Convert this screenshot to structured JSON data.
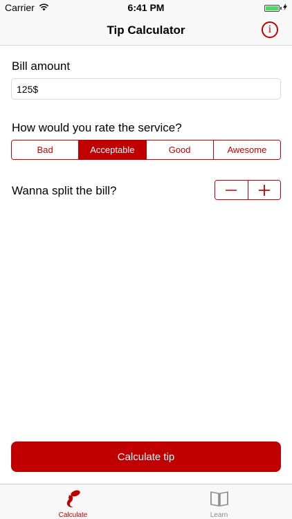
{
  "status_bar": {
    "carrier": "Carrier",
    "time": "6:41 PM",
    "battery_level": 1.0,
    "battery_color": "#4cd964"
  },
  "nav": {
    "title": "Tip Calculator",
    "info_icon": "info-circle-icon",
    "info_glyph": "i"
  },
  "bill": {
    "label": "Bill amount",
    "value": "125$"
  },
  "service": {
    "label": "How would you rate the service?",
    "options": [
      "Bad",
      "Acceptable",
      "Good",
      "Awesome"
    ],
    "selected": "Acceptable"
  },
  "split": {
    "label": "Wanna split the bill?",
    "minus_glyph": "−",
    "plus_glyph": "+"
  },
  "calculate_button": {
    "label": "Calculate tip"
  },
  "tabs": [
    {
      "label": "Calculate",
      "icon": "waiter-icon",
      "active": true
    },
    {
      "label": "Learn",
      "icon": "book-icon",
      "active": false
    }
  ],
  "colors": {
    "accent": "#c00000",
    "inactive": "#8e8e93"
  }
}
